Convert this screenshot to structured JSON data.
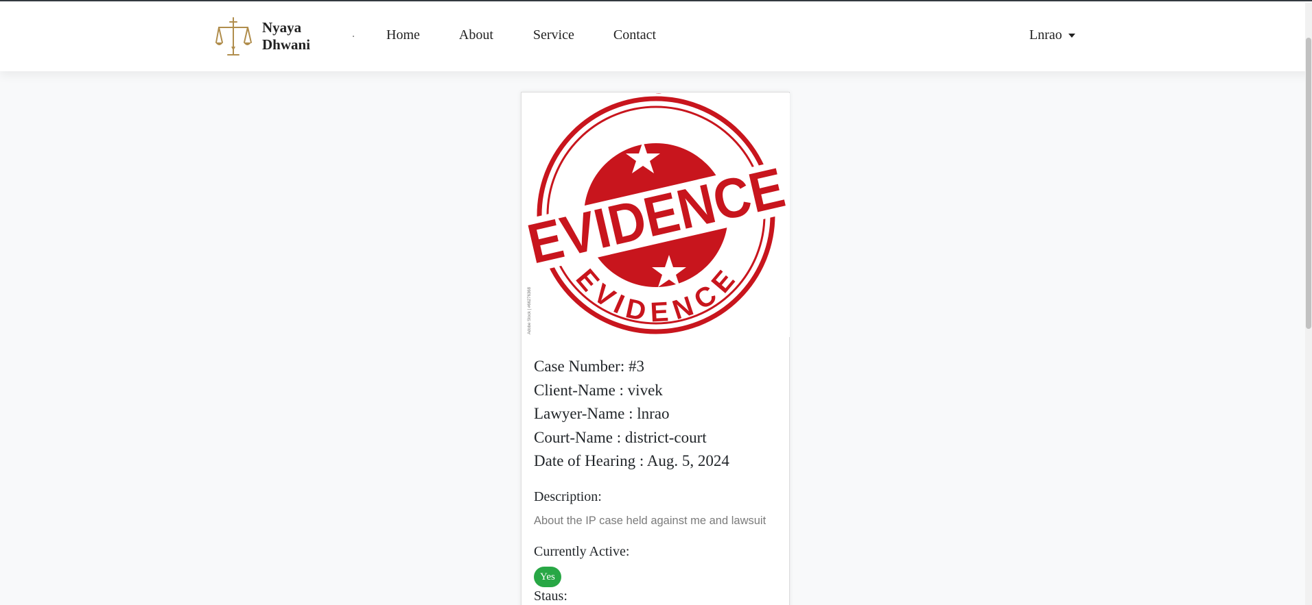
{
  "brand": {
    "name_line1": "Nyaya",
    "name_line2": "Dhwani",
    "logo_icon": "scales-of-justice-icon",
    "accent_color": "#b08d4c"
  },
  "nav": {
    "items": [
      {
        "label": "Home"
      },
      {
        "label": "About"
      },
      {
        "label": "Service"
      },
      {
        "label": "Contact"
      }
    ],
    "user": {
      "label": "Lnrao",
      "icon": "caret-down-icon"
    }
  },
  "case_card": {
    "image": {
      "stamp_text_top": "EVIDENCE",
      "stamp_text_center": "EVIDENCE",
      "stamp_text_bottom": "EVIDENCE",
      "stamp_color": "#c8151d",
      "stock_credit": "Adobe Stock | #66276368"
    },
    "case_number": "Case Number: #3",
    "client_name": "Client-Name : vivek",
    "lawyer_name": "Lawyer-Name : lnrao",
    "court_name": "Court-Name : district-court",
    "hearing_date": "Date of Hearing : Aug. 5, 2024",
    "description_label": "Description:",
    "description_text": "About the IP case held against me and lawsuit",
    "active_label": "Currently Active:",
    "active_badge": "Yes",
    "active_badge_color": "#28a745",
    "status_label": "Staus:"
  }
}
